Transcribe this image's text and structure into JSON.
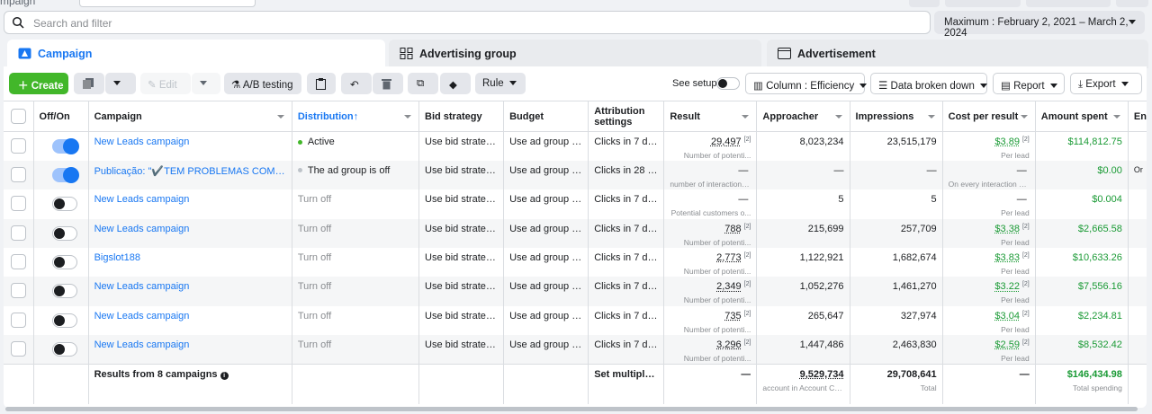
{
  "top": {
    "crumb": "mpaign"
  },
  "search": {
    "placeholder": "Search and filter"
  },
  "date_range": "Maximum : February 2, 2021 – March 2, 2024",
  "tabs": [
    {
      "label": "Campaign"
    },
    {
      "label": "Advertising group"
    },
    {
      "label": "Advertisement"
    }
  ],
  "toolbar": {
    "create": "Create",
    "edit": "Edit",
    "ab_testing": "A/B testing",
    "rule": "Rule",
    "see_setup": "See setup",
    "column": "Column : Efficiency",
    "data_broken_down": "Data broken down",
    "report": "Report",
    "export": "Export"
  },
  "columns": {
    "off_on": "Off/On",
    "campaign": "Campaign",
    "distribution": "Distribution",
    "bid_strategy": "Bid strategy",
    "budget": "Budget",
    "attribution": "Attribution settings",
    "result": "Result",
    "approacher": "Approacher",
    "impressions": "Impressions",
    "cost_per_result": "Cost per result",
    "amount_spent": "Amount spent",
    "end": "End"
  },
  "rows": [
    {
      "on": true,
      "campaign": "New Leads campaign",
      "distribution": "Active",
      "dist_color": "#42b72a",
      "bid": "Use bid strategie...",
      "budget": "Use ad group bu...",
      "attribution": "Clicks in 7 day...",
      "result": "29,497",
      "result_sup": "[2]",
      "result_sub": "Number of potenti...",
      "approacher": "8,023,234",
      "impressions": "23,515,179",
      "cpr": "$3.89",
      "cpr_sup": "[2]",
      "cpr_sub": "Per lead",
      "spent": "$114,812.75",
      "end": ""
    },
    {
      "on": true,
      "campaign": "Publicação: \"✔️TEM PROBLEMAS COM PIOLHO",
      "distribution": "The ad group is off",
      "dist_color": "#bec3c9",
      "bid": "Use bid strategie...",
      "budget": "Use ad group bu...",
      "attribution": "Clicks in 28 da...",
      "result": "—",
      "result_sup": "",
      "result_sub": "number of interactions...",
      "approacher": "—",
      "impressions": "—",
      "cpr": "—",
      "cpr_sup": "",
      "cpr_sub": "On every interaction wi...",
      "spent": "$0.00",
      "end": "Or"
    },
    {
      "on": false,
      "campaign": "New Leads campaign",
      "distribution": "Turn off",
      "dist_color": "",
      "bid": "Use bid strategie...",
      "budget": "Use ad group bu...",
      "attribution": "Clicks in 7 day...",
      "result": "—",
      "result_sup": "",
      "result_sub": "Potential customers o...",
      "approacher": "5",
      "impressions": "5",
      "cpr": "—",
      "cpr_sup": "",
      "cpr_sub": "Per lead",
      "spent": "$0.004",
      "end": ""
    },
    {
      "on": false,
      "campaign": "New Leads campaign",
      "distribution": "Turn off",
      "dist_color": "",
      "bid": "Use bid strategie...",
      "budget": "Use ad group bu...",
      "attribution": "Clicks in 7 day...",
      "result": "788",
      "result_sup": "[2]",
      "result_sub": "Number of potenti...",
      "approacher": "215,699",
      "impressions": "257,709",
      "cpr": "$3.38",
      "cpr_sup": "[2]",
      "cpr_sub": "Per lead",
      "spent": "$2,665.58",
      "end": ""
    },
    {
      "on": false,
      "campaign": "Bigslot188",
      "distribution": "Turn off",
      "dist_color": "",
      "bid": "Use bid strategie...",
      "budget": "Use ad group bu...",
      "attribution": "Clicks in 7 day...",
      "result": "2,773",
      "result_sup": "[2]",
      "result_sub": "Number of potenti...",
      "approacher": "1,122,921",
      "impressions": "1,682,674",
      "cpr": "$3.83",
      "cpr_sup": "[2]",
      "cpr_sub": "Per lead",
      "spent": "$10,633.26",
      "end": ""
    },
    {
      "on": false,
      "campaign": "New Leads campaign",
      "distribution": "Turn off",
      "dist_color": "",
      "bid": "Use bid strategie...",
      "budget": "Use ad group bu...",
      "attribution": "Clicks in 7 day...",
      "result": "2,349",
      "result_sup": "[2]",
      "result_sub": "Number of potenti...",
      "approacher": "1,052,276",
      "impressions": "1,461,270",
      "cpr": "$3.22",
      "cpr_sup": "[2]",
      "cpr_sub": "Per lead",
      "spent": "$7,556.16",
      "end": ""
    },
    {
      "on": false,
      "campaign": "New Leads campaign",
      "distribution": "Turn off",
      "dist_color": "",
      "bid": "Use bid strategie...",
      "budget": "Use ad group bu...",
      "attribution": "Clicks in 7 day...",
      "result": "735",
      "result_sup": "[2]",
      "result_sub": "Number of potenti...",
      "approacher": "265,647",
      "impressions": "327,974",
      "cpr": "$3.04",
      "cpr_sup": "[2]",
      "cpr_sub": "Per lead",
      "spent": "$2,234.81",
      "end": ""
    },
    {
      "on": false,
      "campaign": "New Leads campaign",
      "distribution": "Turn off",
      "dist_color": "",
      "bid": "Use bid strategie...",
      "budget": "Use ad group bu...",
      "attribution": "Clicks in 7 day...",
      "result": "3,296",
      "result_sup": "[2]",
      "result_sub": "Number of potenti...",
      "approacher": "1,447,486",
      "impressions": "2,463,830",
      "cpr": "$2.59",
      "cpr_sup": "[2]",
      "cpr_sub": "Per lead",
      "spent": "$8,532.42",
      "end": ""
    }
  ],
  "footer": {
    "label": "Results from 8 campaigns",
    "attribution": "Set multiple pr...",
    "result": "—",
    "approacher": "9,529,734",
    "approacher_sub": "account in Account Ce...",
    "impressions": "29,708,641",
    "impressions_sub": "Total",
    "cpr": "—",
    "spent": "$146,434.98",
    "spent_sub": "Total spending"
  },
  "colors": {
    "accent": "#1877f2",
    "create": "#42b72a",
    "money": "#1a9a35"
  }
}
